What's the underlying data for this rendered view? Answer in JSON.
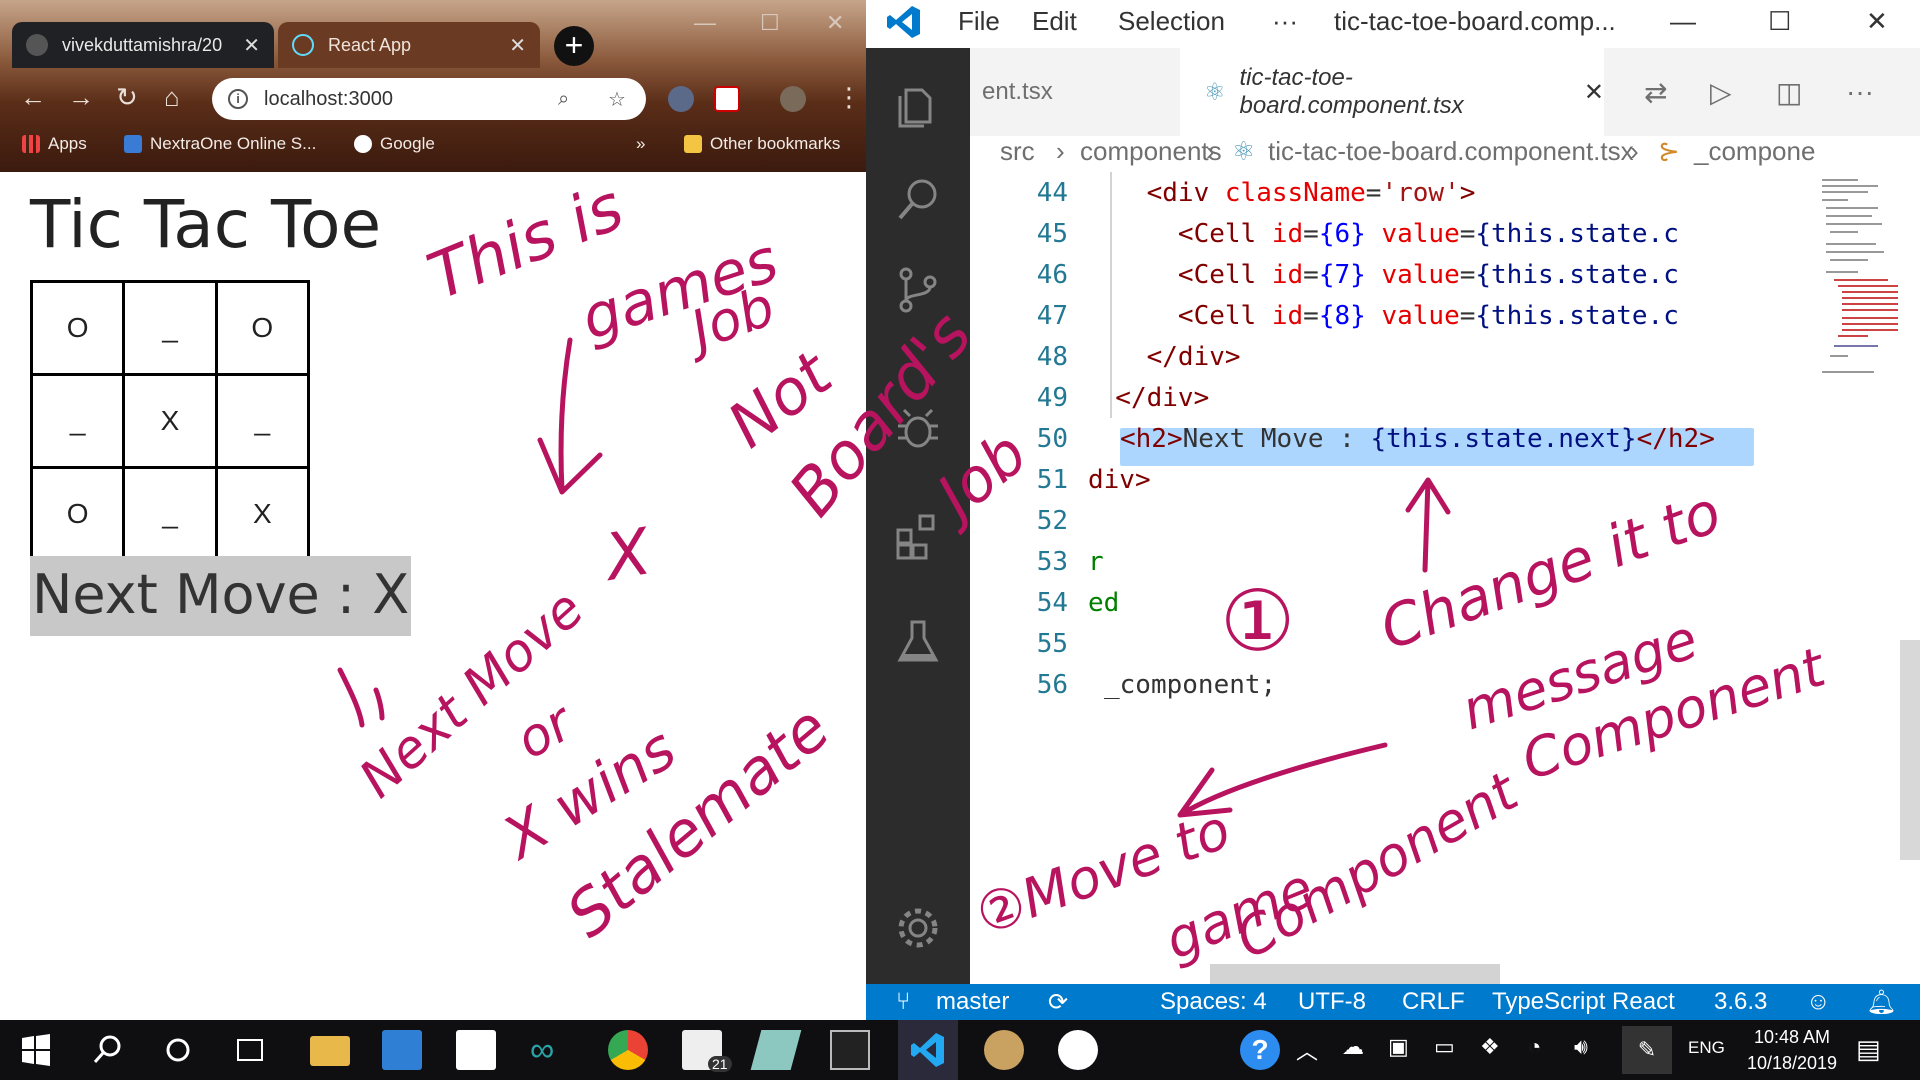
{
  "browser": {
    "tabs": [
      {
        "label": "vivekduttamishra/20"
      },
      {
        "label": "React App"
      }
    ],
    "address": "localhost:3000",
    "bookmarks": [
      {
        "label": "Apps"
      },
      {
        "label": "NextraOne Online S..."
      },
      {
        "label": "Google"
      },
      {
        "label": "»"
      },
      {
        "label": "Other bookmarks"
      }
    ]
  },
  "app": {
    "title": "Tic Tac Toe",
    "board": [
      [
        "O",
        "_",
        "O"
      ],
      [
        "_",
        "X",
        "_"
      ],
      [
        "O",
        "_",
        "X"
      ]
    ],
    "next_move": "Next Move : X"
  },
  "vscode": {
    "menu": [
      "File",
      "Edit",
      "Selection",
      "···"
    ],
    "window_title": "tic-tac-toe-board.comp...",
    "tabs": [
      {
        "label": "ent.tsx"
      },
      {
        "label": "tic-tac-toe-board.component.tsx"
      }
    ],
    "breadcrumb": {
      "src": "src",
      "components": "components",
      "file": "tic-tac-toe-board.component.tsx",
      "symbol": "_compone"
    },
    "line_numbers": [
      "44",
      "45",
      "46",
      "47",
      "48",
      "49",
      "50",
      "51",
      "52",
      "53",
      "54",
      "55",
      "56"
    ],
    "code": {
      "l44": {
        "indent": "    ",
        "open": "<div",
        "attr": " className",
        "eq": "=",
        "str": "'row'",
        "close": ">"
      },
      "l45": {
        "indent": "      ",
        "open": "<Cell",
        "attr": " id",
        "eq": "=",
        "b1": "{6}",
        "attr2": " value",
        "eq2": "=",
        "b2": "{this.state.c"
      },
      "l46": {
        "indent": "      ",
        "open": "<Cell",
        "attr": " id",
        "eq": "=",
        "b1": "{7}",
        "attr2": " value",
        "eq2": "=",
        "b2": "{this.state.c"
      },
      "l47": {
        "indent": "      ",
        "open": "<Cell",
        "attr": " id",
        "eq": "=",
        "b1": "{8}",
        "attr2": " value",
        "eq2": "=",
        "b2": "{this.state.c"
      },
      "l48": "    </div>",
      "l49": "  </div>",
      "l50": {
        "open": "<h2>",
        "text": "Next Move : ",
        "expr": "{this.state.next}",
        "close": "</h2>"
      },
      "l51": "div>",
      "l52": "",
      "l53": "r",
      "l54": "ed",
      "l55": "",
      "l56": "_component;"
    },
    "status": {
      "branch": "master",
      "spaces": "Spaces: 4",
      "encoding": "UTF-8",
      "eol": "CRLF",
      "language": "TypeScript React",
      "version": "3.6.3"
    }
  },
  "taskbar": {
    "mail_badge": "21",
    "lang": "ENG",
    "time": "10:48 AM",
    "date": "10/18/2019"
  },
  "annotations": {
    "this_is_games_job": [
      "This is",
      "games",
      "Job"
    ],
    "not_board_job": [
      "Not",
      "Board's",
      "Job"
    ],
    "x_mark": "X",
    "next_move_list": [
      "Next Move",
      "or",
      "X wins",
      "Stalemate"
    ],
    "step1": "①",
    "change_it_to": "Change it to",
    "message_component": [
      "message",
      "Component"
    ],
    "step2": "②Move to",
    "game_component": [
      "game",
      "Component"
    ]
  },
  "colors": {
    "ink": "#b7135f",
    "vscode_blue": "#007acc",
    "activity_bar": "#2c2c2c",
    "highlight": "#add6ff"
  }
}
